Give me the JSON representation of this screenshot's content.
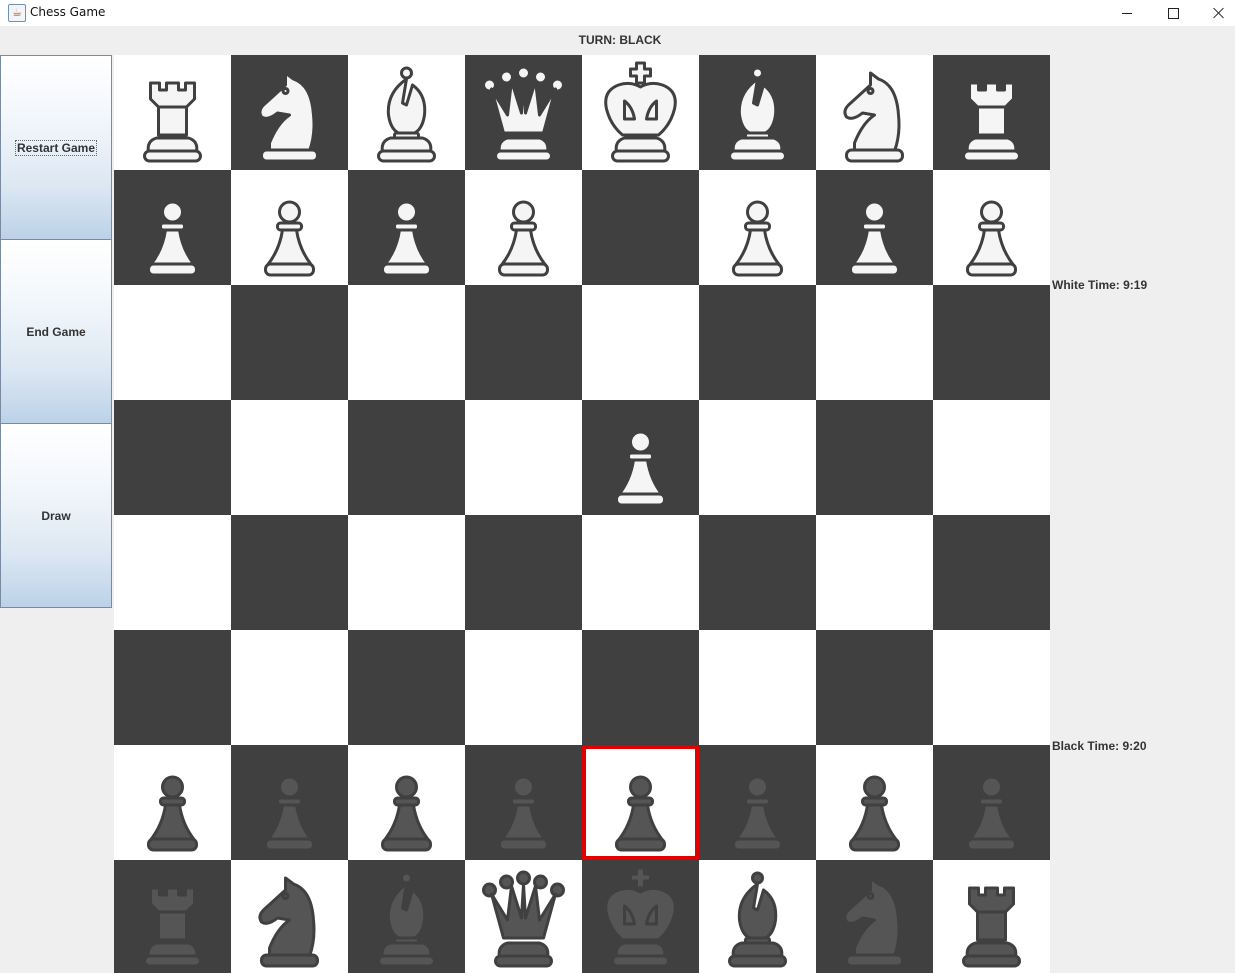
{
  "window": {
    "title": "Chess Game",
    "app_icon": "java-cup-icon"
  },
  "turn": {
    "text": "TURN: BLACK"
  },
  "sidebar": {
    "restart_label": "Restart Game",
    "end_label": "End Game",
    "draw_label": "Draw"
  },
  "timers": {
    "white": "White Time: 9:19",
    "black": "Black Time: 9:20"
  },
  "colors": {
    "light_square": "#ffffff",
    "dark_square": "#404040",
    "selected_border": "#e00000",
    "white_piece_fill": "#f5f5f5",
    "black_piece_fill": "#555555",
    "piece_outline": "#404040"
  },
  "board": {
    "ranks": [
      [
        "wR",
        "wN",
        "wB",
        "wQ",
        "wK",
        "wB",
        "wN",
        "wR"
      ],
      [
        "wP",
        "wP",
        "wP",
        "wP",
        "",
        "wP",
        "wP",
        "wP"
      ],
      [
        "",
        "",
        "",
        "",
        "",
        "",
        "",
        ""
      ],
      [
        "",
        "",
        "",
        "",
        "wP",
        "",
        "",
        ""
      ],
      [
        "",
        "",
        "",
        "",
        "",
        "",
        "",
        ""
      ],
      [
        "",
        "",
        "",
        "",
        "",
        "",
        "",
        ""
      ],
      [
        "bP",
        "bP",
        "bP",
        "bP",
        "bP",
        "bP",
        "bP",
        "bP"
      ],
      [
        "bR",
        "bN",
        "bB",
        "bQ",
        "bK",
        "bB",
        "bN",
        "bR"
      ]
    ],
    "selected_square": [
      6,
      4
    ]
  }
}
